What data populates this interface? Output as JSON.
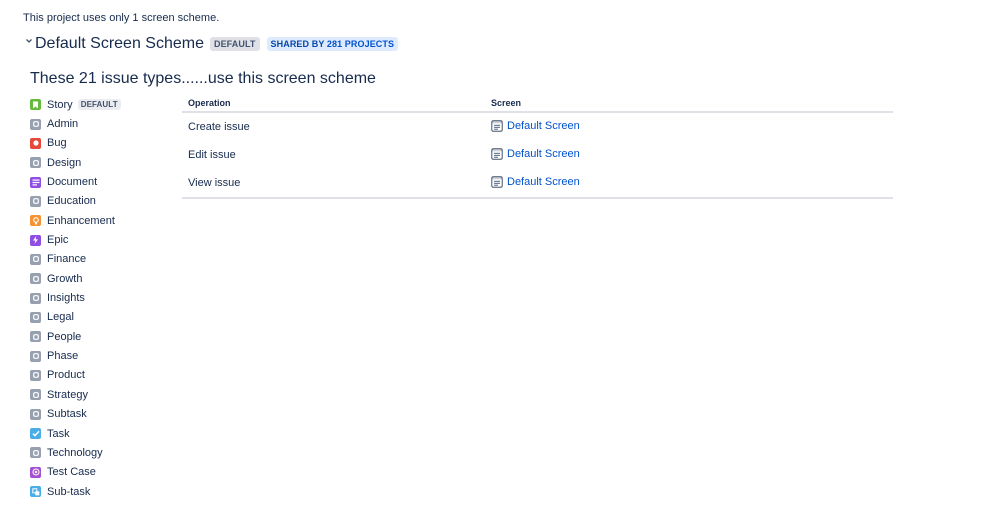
{
  "intro_text": "This project uses only 1 screen scheme.",
  "scheme": {
    "title": "Default Screen Scheme",
    "default_badge": "DEFAULT",
    "shared_prefix": "SHARED BY ",
    "shared_link": "281 PROJECTS"
  },
  "section_title": "These 21 issue types......use this screen scheme",
  "issue_types": [
    {
      "label": "Story",
      "icon": "story-icon",
      "color": "#63ba3c",
      "badge": "DEFAULT"
    },
    {
      "label": "Admin",
      "icon": "generic-issue-icon",
      "color": "#97a0af"
    },
    {
      "label": "Bug",
      "icon": "bug-icon",
      "color": "#e5493a"
    },
    {
      "label": "Design",
      "icon": "generic-issue-icon",
      "color": "#97a0af"
    },
    {
      "label": "Document",
      "icon": "document-icon",
      "color": "#904ee2"
    },
    {
      "label": "Education",
      "icon": "generic-issue-icon",
      "color": "#97a0af"
    },
    {
      "label": "Enhancement",
      "icon": "enhancement-icon",
      "color": "#f79232"
    },
    {
      "label": "Epic",
      "icon": "epic-icon",
      "color": "#904ee2"
    },
    {
      "label": "Finance",
      "icon": "generic-issue-icon",
      "color": "#97a0af"
    },
    {
      "label": "Growth",
      "icon": "generic-issue-icon",
      "color": "#97a0af"
    },
    {
      "label": "Insights",
      "icon": "generic-issue-icon",
      "color": "#97a0af"
    },
    {
      "label": "Legal",
      "icon": "generic-issue-icon",
      "color": "#97a0af"
    },
    {
      "label": "People",
      "icon": "generic-issue-icon",
      "color": "#97a0af"
    },
    {
      "label": "Phase",
      "icon": "generic-issue-icon",
      "color": "#97a0af"
    },
    {
      "label": "Product",
      "icon": "generic-issue-icon",
      "color": "#97a0af"
    },
    {
      "label": "Strategy",
      "icon": "generic-issue-icon",
      "color": "#97a0af"
    },
    {
      "label": "Subtask",
      "icon": "generic-issue-icon",
      "color": "#97a0af"
    },
    {
      "label": "Task",
      "icon": "task-icon",
      "color": "#4bade8"
    },
    {
      "label": "Technology",
      "icon": "generic-issue-icon",
      "color": "#97a0af"
    },
    {
      "label": "Test Case",
      "icon": "test-case-icon",
      "color": "#a54fd1"
    },
    {
      "label": "Sub-task",
      "icon": "subtask-icon",
      "color": "#4bade8"
    }
  ],
  "table": {
    "headers": {
      "operation": "Operation",
      "screen": "Screen"
    },
    "rows": [
      {
        "operation": "Create issue",
        "screen": "Default Screen"
      },
      {
        "operation": "Edit issue",
        "screen": "Default Screen"
      },
      {
        "operation": "View issue",
        "screen": "Default Screen"
      }
    ]
  },
  "colors": {
    "text": "#172b4d",
    "link": "#0052cc",
    "border": "#dfe1e6"
  }
}
